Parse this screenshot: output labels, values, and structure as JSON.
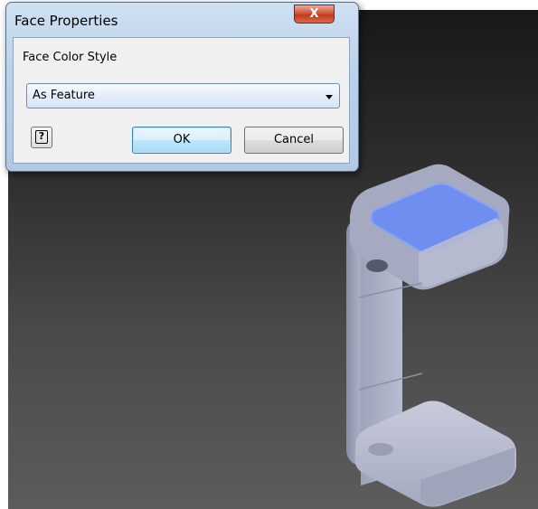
{
  "dialog": {
    "title": "Face Properties",
    "close_label": "X",
    "field_label": "Face Color Style",
    "select_value": "As Feature",
    "help_label": "?",
    "ok_label": "OK",
    "cancel_label": "Cancel"
  },
  "colors": {
    "selected_face": "#6f8ff0",
    "part_body": "#b4b8cc",
    "viewport_top": "#181818",
    "viewport_bottom": "#5c5c5c",
    "ok_border": "#3c7fb1"
  },
  "icons": {
    "close": "close-icon",
    "help": "help-icon",
    "dropdown": "chevron-down-icon"
  }
}
